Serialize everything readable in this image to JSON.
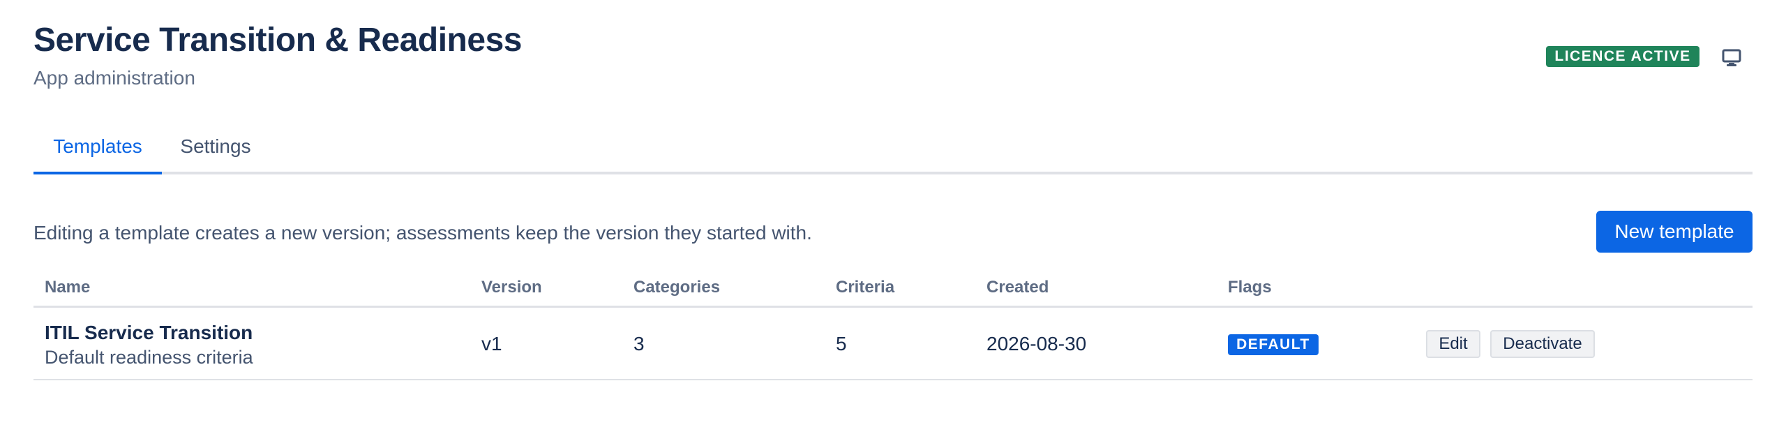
{
  "header": {
    "title": "Service Transition & Readiness",
    "subtitle": "App administration",
    "licence_badge": "LICENCE ACTIVE",
    "monitor_icon": "monitor-icon"
  },
  "tabs": [
    {
      "label": "Templates",
      "active": true
    },
    {
      "label": "Settings",
      "active": false
    }
  ],
  "toolbar": {
    "helper_text": "Editing a template creates a new version; assessments keep the version they started with.",
    "new_template_label": "New template"
  },
  "table": {
    "columns": [
      "Name",
      "Version",
      "Categories",
      "Criteria",
      "Created",
      "Flags"
    ],
    "rows": [
      {
        "name": "ITIL Service Transition",
        "description": "Default readiness criteria",
        "version": "v1",
        "categories": "3",
        "criteria": "5",
        "created": "2026-08-30",
        "flag": "DEFAULT",
        "actions": [
          "Edit",
          "Deactivate"
        ]
      }
    ]
  },
  "colors": {
    "accent": "#0c66e4",
    "success": "#1f845a",
    "text": "#172b4d",
    "muted": "#5e6c84"
  }
}
